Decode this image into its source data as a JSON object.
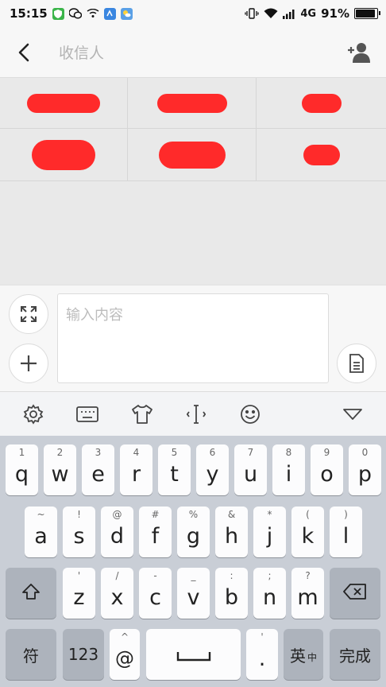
{
  "status_bar": {
    "time": "15:15",
    "network": "4G",
    "battery": "91%",
    "battery_fraction": 0.91,
    "left_icons": [
      "shield-icon",
      "wechat-icon",
      "wifi-signal-icon",
      "app-icon",
      "weather-icon"
    ],
    "right_icons": [
      "vibrate-icon",
      "wifi-icon",
      "signal-icon",
      "battery-icon"
    ]
  },
  "header": {
    "title": "收信人",
    "back_icon": "back-arrow-icon",
    "add_icon": "add-contact-icon"
  },
  "recipients": [
    {
      "name": "",
      "redacted": true
    },
    {
      "name": "",
      "redacted": true
    },
    {
      "name": "",
      "redacted": true
    },
    {
      "name": "",
      "redacted": true
    },
    {
      "name": "",
      "redacted": true
    },
    {
      "name": "",
      "redacted": true
    }
  ],
  "composer": {
    "placeholder": "输入内容",
    "expand_icon": "expand-icon",
    "add_icon": "plus-icon",
    "template_icon": "document-icon"
  },
  "keyboard_toolbar": {
    "icons": [
      "settings-icon",
      "keyboard-icon",
      "skin-icon",
      "cursor-icon",
      "emoji-icon",
      "collapse-icon"
    ]
  },
  "keyboard": {
    "row1": [
      {
        "main": "q",
        "sub": "1"
      },
      {
        "main": "w",
        "sub": "2"
      },
      {
        "main": "e",
        "sub": "3"
      },
      {
        "main": "r",
        "sub": "4"
      },
      {
        "main": "t",
        "sub": "5"
      },
      {
        "main": "y",
        "sub": "6"
      },
      {
        "main": "u",
        "sub": "7"
      },
      {
        "main": "i",
        "sub": "8"
      },
      {
        "main": "o",
        "sub": "9"
      },
      {
        "main": "p",
        "sub": "0"
      }
    ],
    "row2": [
      {
        "main": "a",
        "sub": "~"
      },
      {
        "main": "s",
        "sub": "!"
      },
      {
        "main": "d",
        "sub": "@"
      },
      {
        "main": "f",
        "sub": "#"
      },
      {
        "main": "g",
        "sub": "%"
      },
      {
        "main": "h",
        "sub": "&"
      },
      {
        "main": "j",
        "sub": "*"
      },
      {
        "main": "k",
        "sub": "("
      },
      {
        "main": "l",
        "sub": ")"
      }
    ],
    "row3": [
      {
        "main": "z",
        "sub": "'"
      },
      {
        "main": "x",
        "sub": "/"
      },
      {
        "main": "c",
        "sub": "-"
      },
      {
        "main": "v",
        "sub": "_"
      },
      {
        "main": "b",
        "sub": ":"
      },
      {
        "main": "n",
        "sub": ";"
      },
      {
        "main": "m",
        "sub": "?"
      }
    ],
    "shift_icon": "shift-icon",
    "delete_icon": "backspace-icon",
    "symbol": "符",
    "numbers": "123",
    "at": {
      "main": "@",
      "sub": "^"
    },
    "space_icon": "space-icon",
    "period": {
      "main": ".",
      "sub": "'"
    },
    "lang": {
      "main": "英",
      "sub": "中"
    },
    "done": "完成"
  }
}
